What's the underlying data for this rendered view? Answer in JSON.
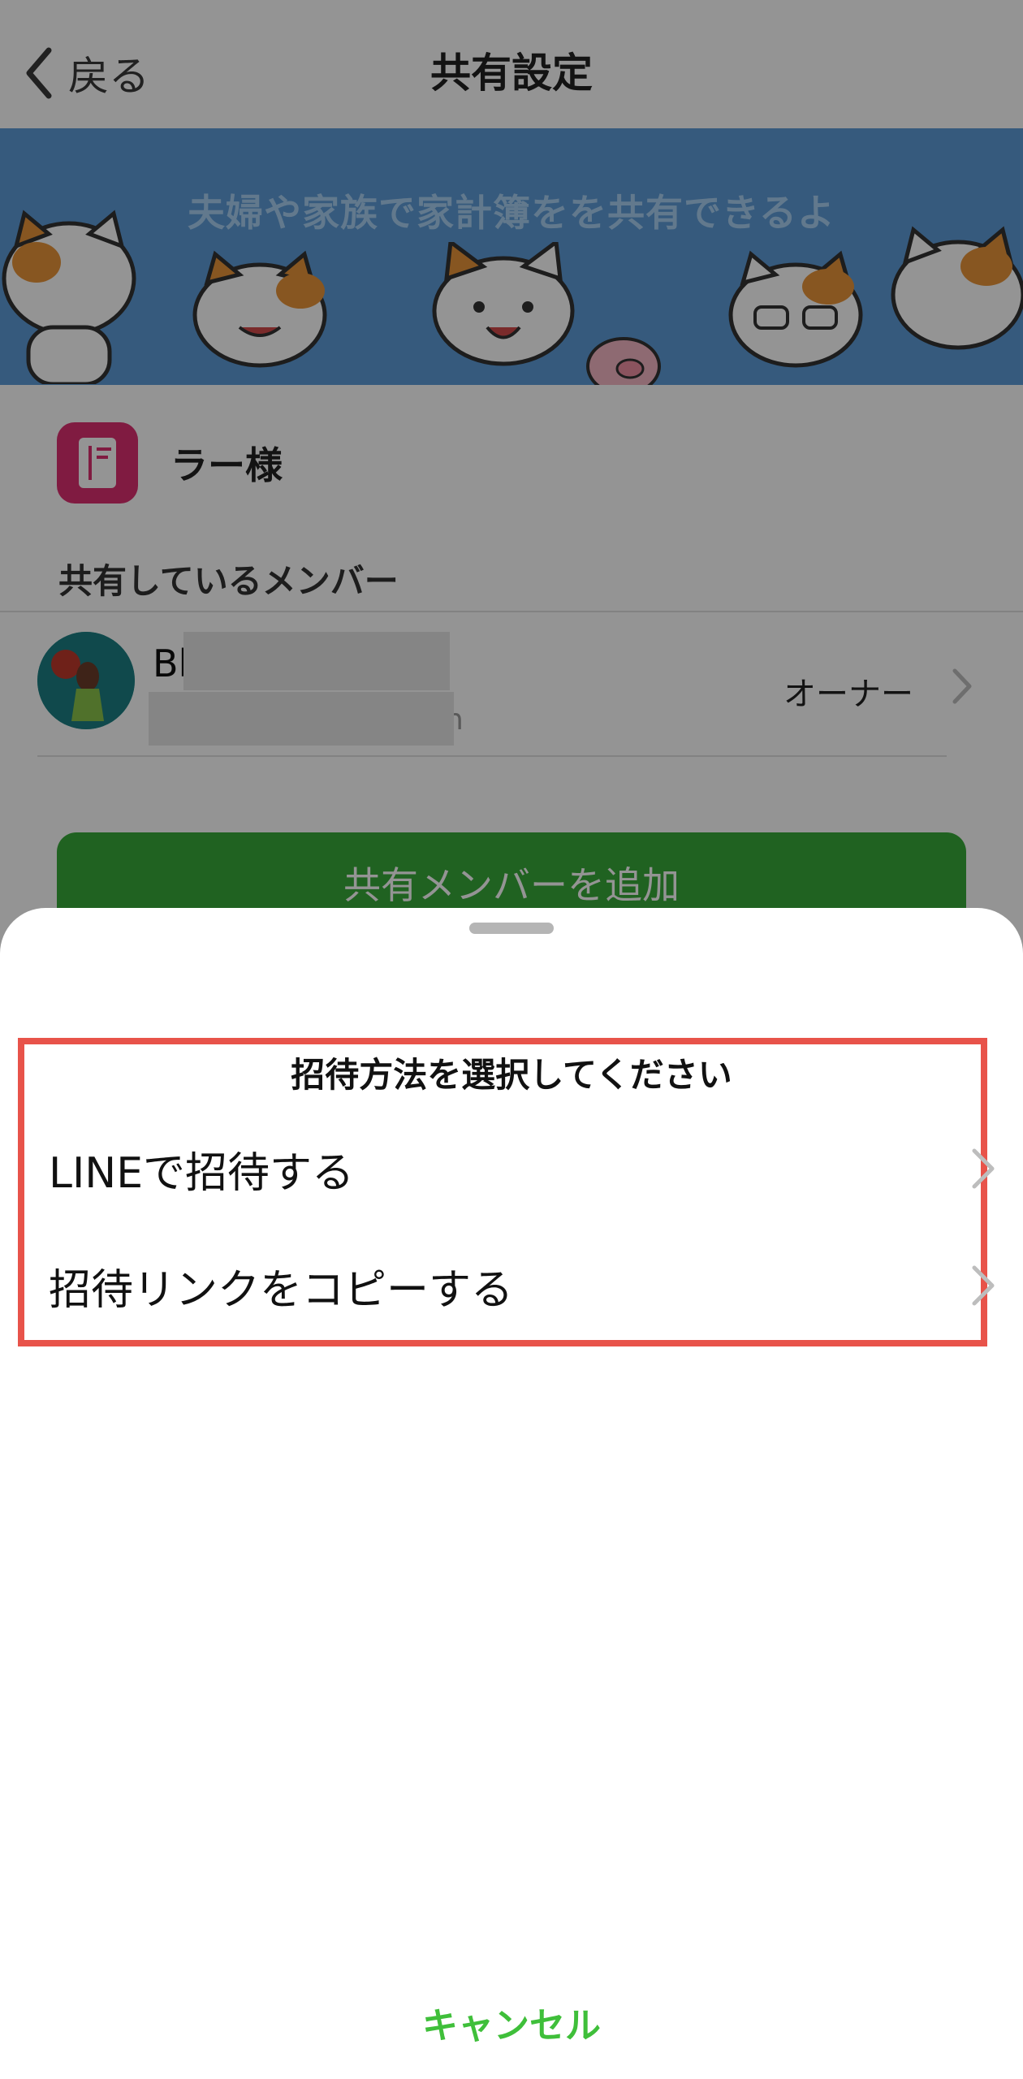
{
  "navbar": {
    "back_label": "戻る",
    "title": "共有設定"
  },
  "banner": {
    "text": "夫婦や家族で家計簿をを共有できるよ"
  },
  "book": {
    "name": "ラー様",
    "icon": "notebook-icon"
  },
  "members": {
    "section_label": "共有しているメンバー",
    "items": [
      {
        "name": "Bl",
        "sub_tail": "n",
        "role": "オーナー"
      }
    ]
  },
  "add_member_label": "共有メンバーを追加",
  "sheet": {
    "title": "招待方法を選択してください",
    "options": [
      {
        "label": "LINEで招待する"
      },
      {
        "label": "招待リンクをコピーする"
      }
    ],
    "cancel_label": "キャンセル",
    "highlight_color": "#e8534a",
    "cancel_color": "#3fbf3a"
  },
  "colors": {
    "banner": "#5d9bd7",
    "add_button": "#37a93a",
    "book_icon": "#dd2f71"
  }
}
